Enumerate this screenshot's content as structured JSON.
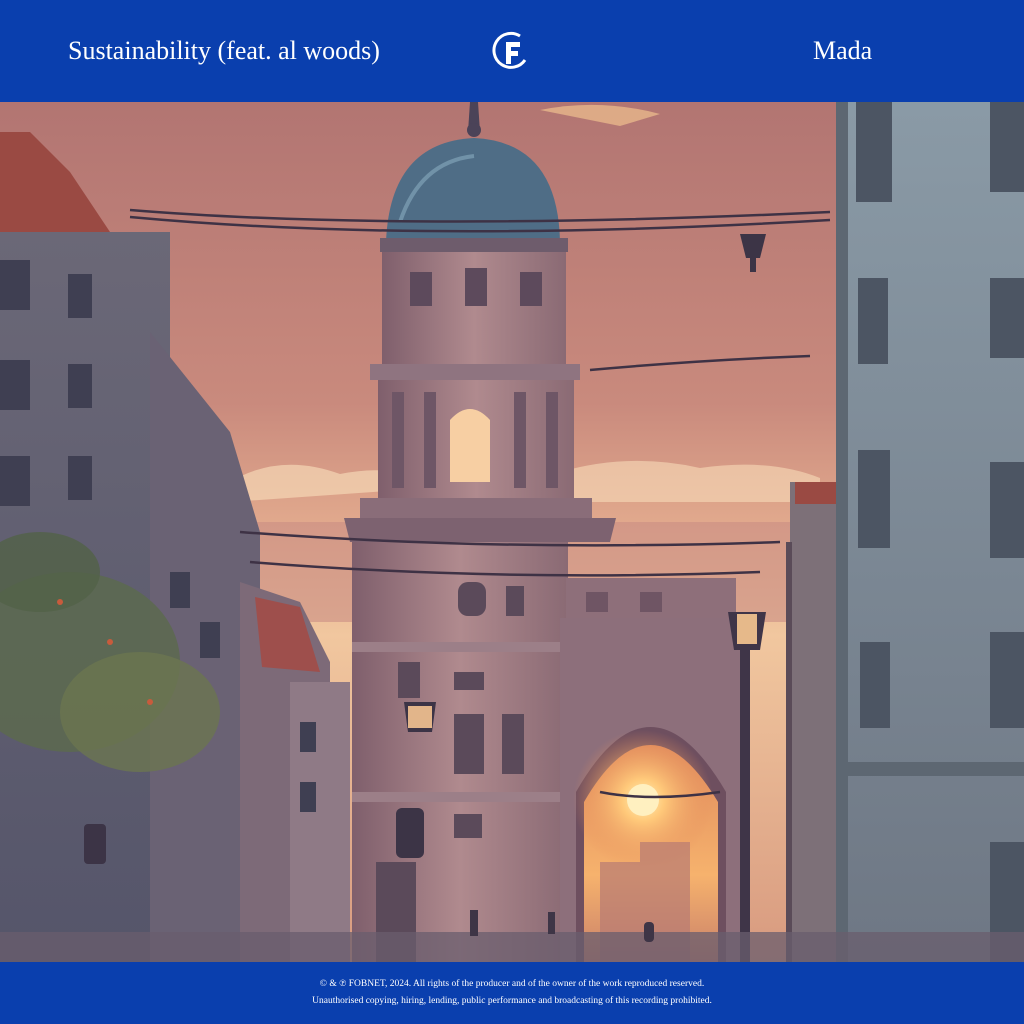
{
  "header": {
    "track_title": "Sustainability (feat. al woods)",
    "artist": "Mada",
    "logo_icon": "fobnet-f-logo-icon"
  },
  "artwork": {
    "subject": "city-street-sunset-illustration"
  },
  "footer": {
    "copyright_line": "© & ℗ FOBNET, 2024. All rights of the producer and of the owner of the work reproduced reserved.",
    "notice_line": "Unauthorised copying, hiring, lending, public performance and broadcasting of this recording prohibited."
  },
  "colors": {
    "brand_blue": "#0a3fae",
    "text": "#ffffff",
    "sky_top": "#b77a74",
    "sky_glow": "#f3c8a0",
    "sun": "#ffd98a"
  }
}
